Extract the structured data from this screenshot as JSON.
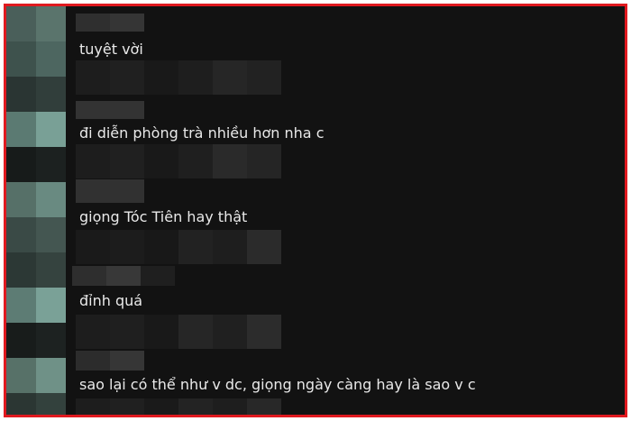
{
  "theme": {
    "frame_border": "#e0191f",
    "background": "#121212",
    "text_color": "#e9e9e9"
  },
  "comments": [
    {
      "text": "tuyệt vời"
    },
    {
      "text": "đi diễn phòng trà nhiều hơn nha c"
    },
    {
      "text": "giọng Tóc Tiên hay thật"
    },
    {
      "text": "đỉnh quá"
    },
    {
      "text": "sao lại có thể như v dc, giọng ngày càng hay là sao v c"
    }
  ]
}
